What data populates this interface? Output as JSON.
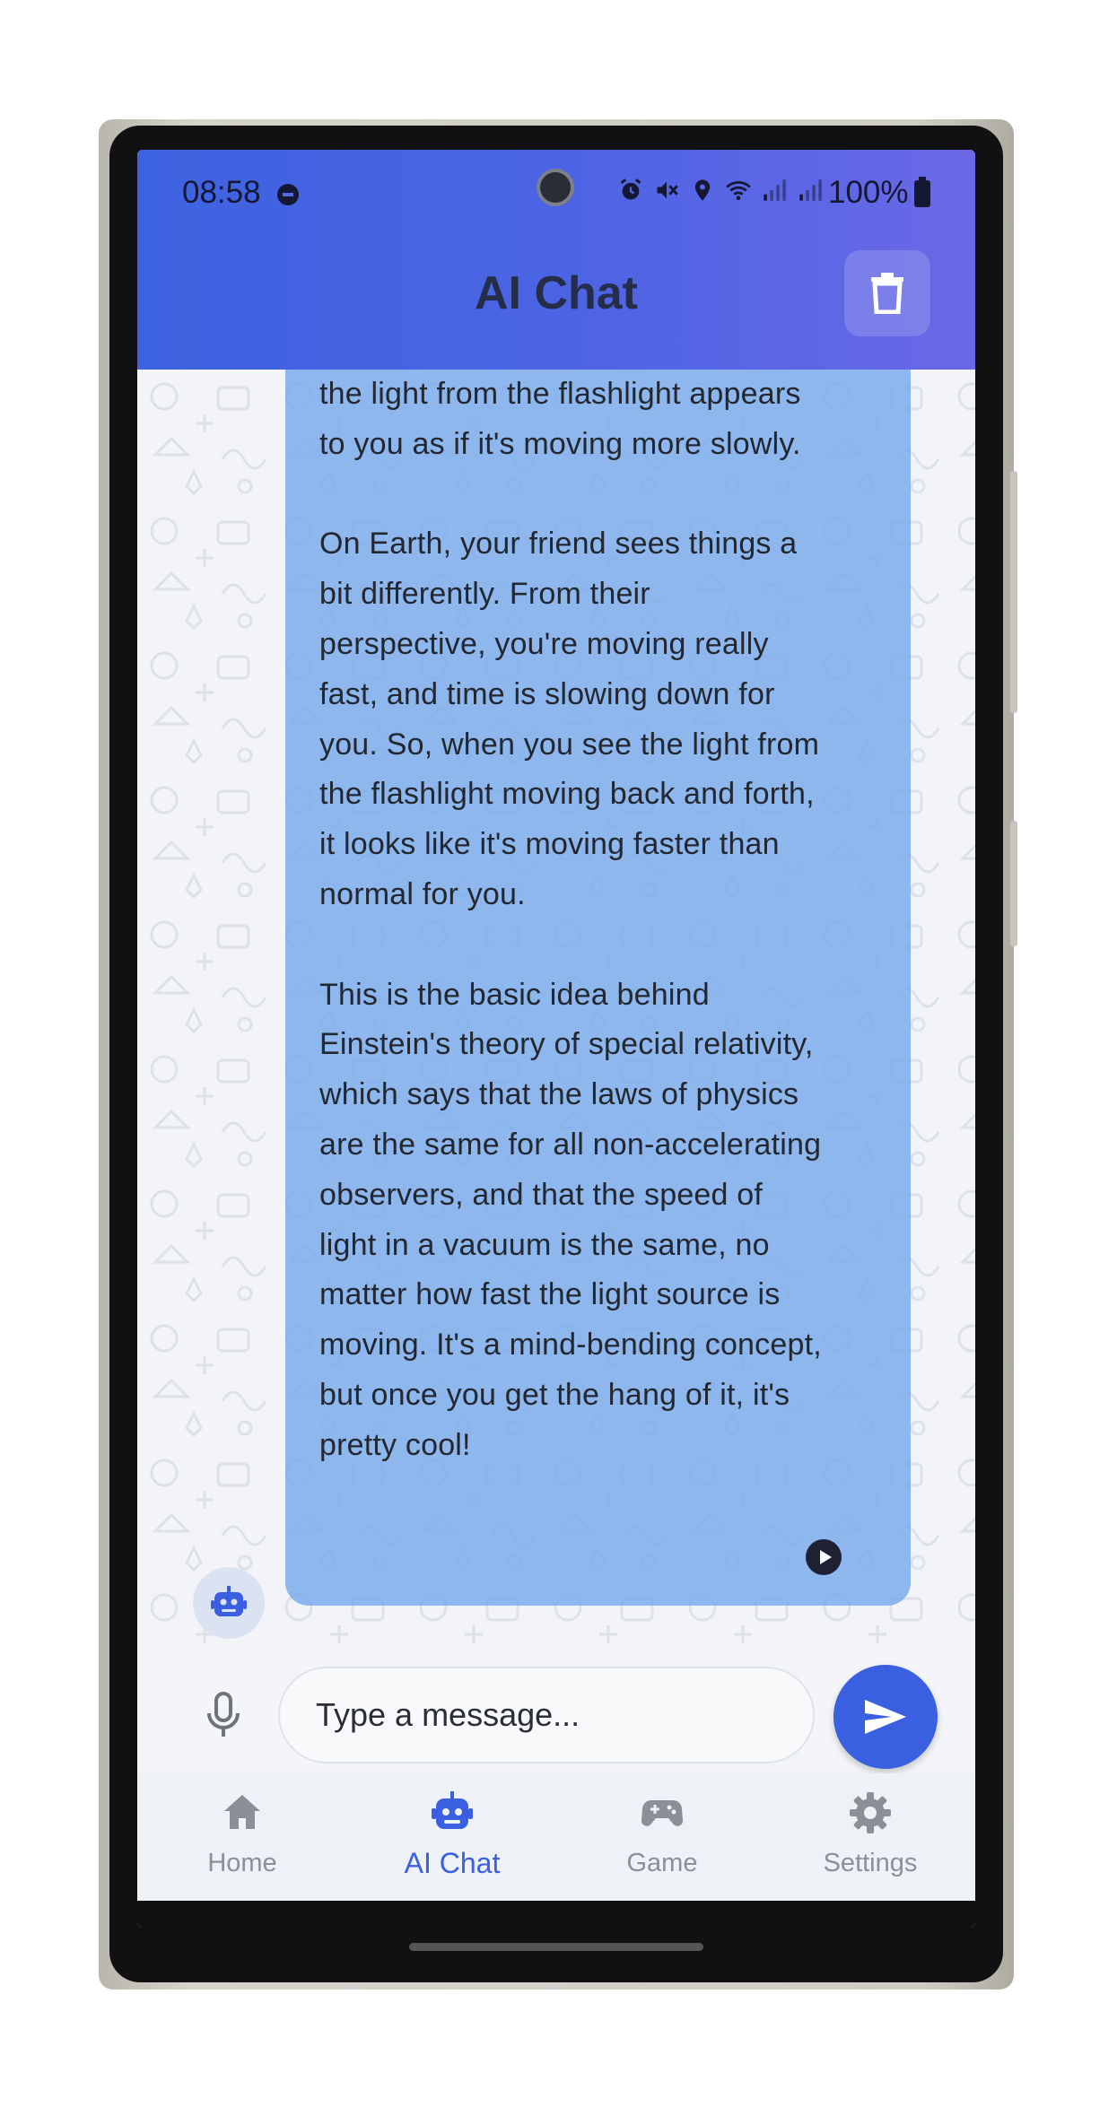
{
  "status_bar": {
    "time": "08:58",
    "battery": "100%",
    "icons": [
      "alarm-icon",
      "mute-icon",
      "location-icon",
      "wifi-icon",
      "signal-icon",
      "signal-icon",
      "battery-icon"
    ]
  },
  "header": {
    "title": "AI Chat",
    "trash_icon": "trash-icon"
  },
  "chat": {
    "messages": [
      {
        "sender": "bot",
        "text": "the light from the flashlight appears\nto you as if it's moving more slowly.\n\nOn Earth, your friend sees things a\nbit differently. From their\nperspective, you're moving really\nfast, and time is slowing down for\nyou. So, when you see the light from\nthe flashlight moving back and forth,\nit looks like it's moving faster than\nnormal for you.\n\nThis is the basic idea behind\nEinstein's theory of special relativity,\nwhich says that the laws of physics\nare the same for all non-accelerating\nobservers, and that the speed of\nlight in a vacuum is the same, no\nmatter how fast the light source is\nmoving. It's a mind-bending concept,\nbut once you get the hang of it, it's\npretty cool!"
      }
    ]
  },
  "input": {
    "placeholder": "Type a message...",
    "value": ""
  },
  "nav": {
    "items": [
      {
        "label": "Home",
        "icon": "home-icon",
        "active": false
      },
      {
        "label": "AI Chat",
        "icon": "robot-icon",
        "active": true
      },
      {
        "label": "Game",
        "icon": "gamepad-icon",
        "active": false
      },
      {
        "label": "Settings",
        "icon": "gear-icon",
        "active": false
      }
    ]
  },
  "colors": {
    "header_start": "#3e63e0",
    "header_end": "#6a68e6",
    "accent": "#3a5fe0",
    "bubble": "#8ab8f0",
    "nav_inactive": "#8b8f98"
  }
}
